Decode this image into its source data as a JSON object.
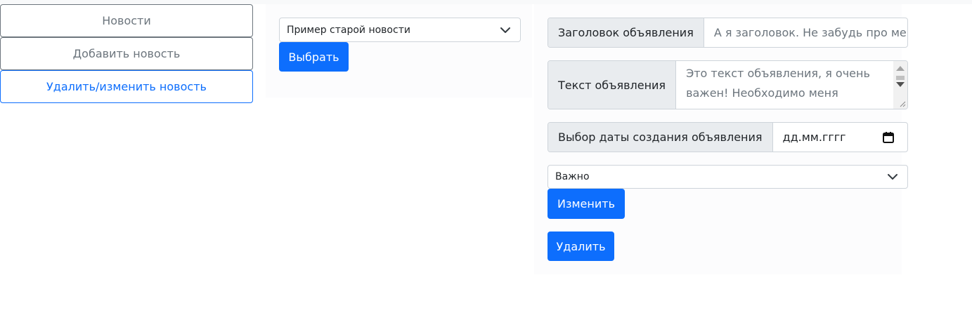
{
  "nav": {
    "items": [
      {
        "label": "Новости"
      },
      {
        "label": "Добавить новость"
      },
      {
        "label": "Удалить/изменить новость"
      }
    ]
  },
  "middle": {
    "news_select": {
      "value": "Пример старой новости"
    },
    "choose_button": "Выбрать"
  },
  "form": {
    "title": {
      "label": "Заголовок объявления",
      "placeholder": "А я заголовок. Не забудь про ме"
    },
    "text": {
      "label": "Текст объявления",
      "value_line1": "Это текст объявления, я очень",
      "value_line2": "важен! Необходимо меня"
    },
    "date": {
      "label": "Выбор даты создания объявления",
      "placeholder": "дд.мм.гггг"
    },
    "importance_select": {
      "value": "Важно"
    },
    "edit_button": "Изменить",
    "delete_button": "Удалить"
  },
  "colors": {
    "primary": "#0d6efd",
    "secondary": "#6c757d",
    "addon_bg": "#e9ecef",
    "border": "#ced4da"
  }
}
